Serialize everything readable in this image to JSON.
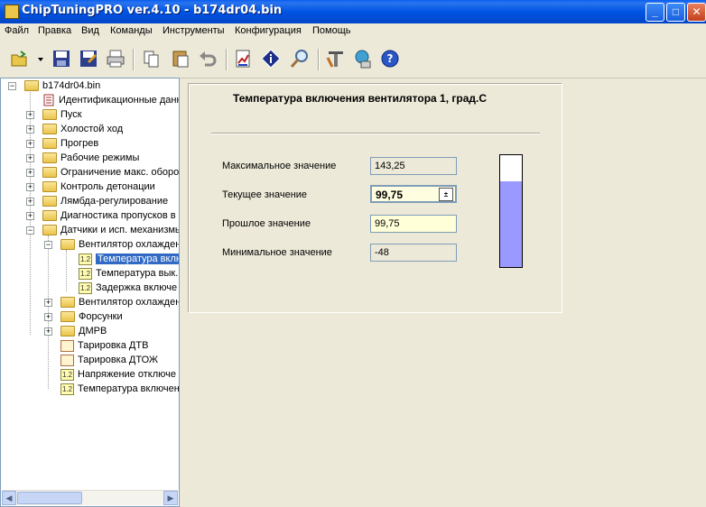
{
  "window": {
    "title": "ChipTuningPRO ver.4.10 - b174dr04.bin"
  },
  "menu": [
    "Файл",
    "Правка",
    "Вид",
    "Команды",
    "Инструменты",
    "Конфигурация",
    "Помощь"
  ],
  "toolbar": {
    "icons": [
      "open-icon",
      "dropdown-arrow-icon",
      "save-icon",
      "save-as-icon",
      "print-icon",
      "copy-icon",
      "paste-icon",
      "undo-icon",
      "chart-edit-icon",
      "info-icon",
      "search-icon",
      "tools-icon",
      "network-icon",
      "help-icon"
    ]
  },
  "tree": {
    "root": "b174dr04.bin",
    "items": [
      {
        "label": "Идентификационные данн",
        "icon": "document-icon"
      },
      {
        "label": "Пуск",
        "icon": "folder-icon"
      },
      {
        "label": "Холостой ход",
        "icon": "folder-icon"
      },
      {
        "label": "Прогрев",
        "icon": "folder-icon"
      },
      {
        "label": "Рабочие режимы",
        "icon": "folder-icon"
      },
      {
        "label": "Ограничение макс. оборот",
        "icon": "folder-icon"
      },
      {
        "label": "Контроль детонации",
        "icon": "folder-icon"
      },
      {
        "label": "Лямбда-регулирование",
        "icon": "folder-icon"
      },
      {
        "label": "Диагностика пропусков в",
        "icon": "folder-icon"
      },
      {
        "label": "Датчики и исп. механизмы",
        "icon": "folder-icon"
      },
      {
        "label": "Вентилятор охлажден",
        "icon": "folder-icon"
      },
      {
        "label": "Температура вклю",
        "icon": "constant-icon"
      },
      {
        "label": "Температура вык.",
        "icon": "constant-icon"
      },
      {
        "label": "Задержка включе",
        "icon": "constant-icon"
      },
      {
        "label": "Вентилятор охлажден",
        "icon": "folder-icon"
      },
      {
        "label": "Форсунки",
        "icon": "folder-icon"
      },
      {
        "label": "ДМРВ",
        "icon": "folder-icon"
      },
      {
        "label": "Тарировка ДТВ",
        "icon": "chart-icon"
      },
      {
        "label": "Тарировка ДТОЖ",
        "icon": "chart-icon"
      },
      {
        "label": "Напряжение отключе",
        "icon": "constant-icon"
      },
      {
        "label": "Температура включен",
        "icon": "constant-icon"
      }
    ],
    "badge_text": "1.2"
  },
  "editor": {
    "title": "Температура включения вентилятора 1, град.С",
    "max_label": "Максимальное значение",
    "max_value": "143,25",
    "current_label": "Текущее значение",
    "current_value": "99,75",
    "previous_label": "Прошлое значение",
    "previous_value": "99,75",
    "min_label": "Минимальное значение",
    "min_value": "-48",
    "gauge_fraction": 0.77
  },
  "colors": {
    "gauge_fill": "#9999ff",
    "selection": "#316ac5"
  }
}
